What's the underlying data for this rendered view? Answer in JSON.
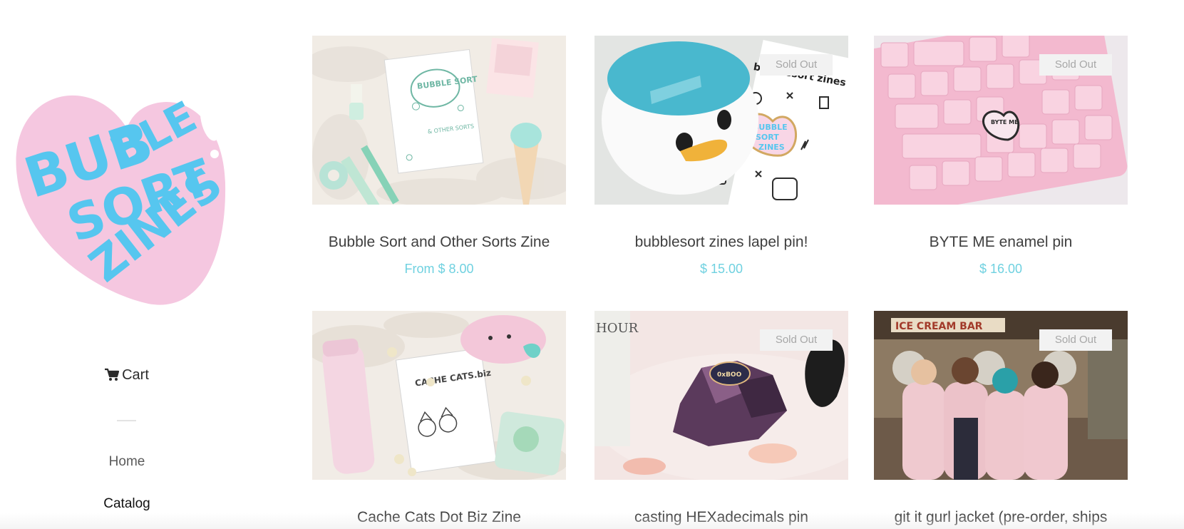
{
  "brand": {
    "logo_text": "BUBBLE SORT ZINES",
    "colors": {
      "heart": "#f5c7e0",
      "letters": "#56c6ef"
    }
  },
  "nav": {
    "cart_label": "Cart",
    "cart_icon": "shopping-cart-icon",
    "home_label": "Home",
    "catalog_label": "Catalog"
  },
  "colors": {
    "price": "#6fd1e0",
    "badge_bg": "#f2f2f2",
    "badge_text": "#a7a7a7"
  },
  "products": [
    {
      "title": "Bubble Sort and Other Sorts Zine",
      "price": "From $ 8.00",
      "sold_out": false,
      "badge": ""
    },
    {
      "title": "bubblesort zines lapel pin!",
      "price": "$ 15.00",
      "sold_out": true,
      "badge": "Sold Out"
    },
    {
      "title": "BYTE ME enamel pin",
      "price": "$ 16.00",
      "sold_out": true,
      "badge": "Sold Out"
    },
    {
      "title": "Cache Cats Dot Biz Zine",
      "price": "",
      "sold_out": false,
      "badge": ""
    },
    {
      "title": "casting HEXadecimals pin",
      "price": "",
      "sold_out": true,
      "badge": "Sold Out"
    },
    {
      "title": "git it gurl jacket (pre-order, ships",
      "price": "",
      "sold_out": true,
      "badge": "Sold Out"
    }
  ],
  "image_text": {
    "zine1_cover": "BUBBLE SORT",
    "zine1_sub": "& OTHER SORTS",
    "pin_card": "bubblesort zines",
    "byte_me": "BYTE ME",
    "cache_cats": "CACHE CATS.biz",
    "hex_pin": "0xBOO",
    "bar_sign": "ICE CREAM BAR"
  }
}
